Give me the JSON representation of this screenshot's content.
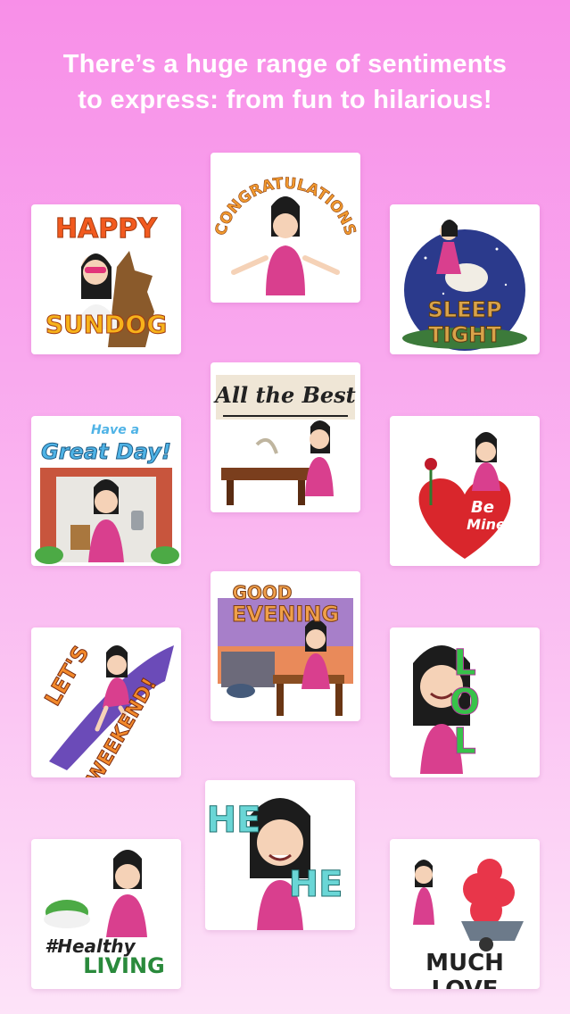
{
  "headline": {
    "line1": "There’s a huge range of sentiments",
    "line2": "to express: from fun to hilarious!"
  },
  "stickers": [
    {
      "id": "happy-sundog",
      "top": "HAPPY",
      "bottom": "SUNDOG",
      "colors": {
        "top": "#f25a1f",
        "bottom": "#f6b21b",
        "stroke": "#a23b10"
      }
    },
    {
      "id": "congratulations",
      "text": "CONGRATULATIONS",
      "colors": {
        "text": "#f29a2e"
      }
    },
    {
      "id": "sleep-tight",
      "text": "SLEEP TIGHT",
      "colors": {
        "sky": "#2b3a8c",
        "text": "#d9a34a"
      }
    },
    {
      "id": "all-the-best",
      "text": "All the Best",
      "colors": {
        "text": "#222222"
      }
    },
    {
      "id": "have-a-great-day",
      "small": "Have a",
      "big": "Great Day!",
      "colors": {
        "text": "#4fb3e6",
        "brick": "#c8553d"
      }
    },
    {
      "id": "be-mine",
      "line1": "Be",
      "line2": "Mine",
      "colors": {
        "heart": "#d9262c"
      }
    },
    {
      "id": "good-evening",
      "line1": "GOOD",
      "line2": "EVENING",
      "colors": {
        "text": "#f0a04a",
        "sky": "#a77fc9"
      }
    },
    {
      "id": "lets-weekend",
      "line1": "LET'S",
      "line2": "WEEKEND!",
      "colors": {
        "text": "#f2892b",
        "swoosh": "#6b4bb8"
      }
    },
    {
      "id": "lol",
      "text": "LOL",
      "colors": {
        "text": "#37c24a",
        "shadow": "#b0389a"
      }
    },
    {
      "id": "he-he",
      "text1": "HE",
      "text2": "HE",
      "colors": {
        "text": "#6ad6d6"
      }
    },
    {
      "id": "healthy-living",
      "line1": "#Healthy",
      "line2": "LIVING",
      "colors": {
        "text": "#2a8a3c"
      }
    },
    {
      "id": "much-love",
      "text": "MUCH LOVE",
      "colors": {
        "text": "#222222",
        "hearts": "#e8364a"
      }
    }
  ]
}
